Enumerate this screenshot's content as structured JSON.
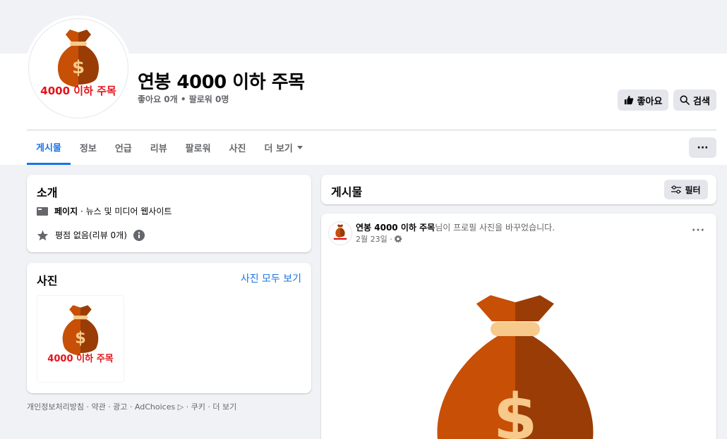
{
  "page": {
    "title": "연봉 4000 이하 주목",
    "stats": "좋아요 0개 • 팔로워 0명",
    "logo_text": "4000 이하 주목",
    "logo_symbol": "$"
  },
  "actions": {
    "like_label": "좋아요",
    "search_label": "검색",
    "more_label": "···"
  },
  "tabs": [
    {
      "label": "게시물"
    },
    {
      "label": "정보"
    },
    {
      "label": "언급"
    },
    {
      "label": "리뷰"
    },
    {
      "label": "팔로워"
    },
    {
      "label": "사진"
    },
    {
      "label": "더 보기"
    }
  ],
  "intro": {
    "title": "소개",
    "category_bold": "페이지",
    "category_rest": " · 뉴스 및 미디어 웹사이트",
    "rating": "평점 없음(리뷰 0개)"
  },
  "photos": {
    "title": "사진",
    "see_all": "사진 모두 보기"
  },
  "footer": {
    "text": "개인정보처리방침 · 약관 · 광고 · AdChoices ▷ · 쿠키 · 더 보기"
  },
  "posts": {
    "title": "게시물",
    "filter_label": "필터",
    "item": {
      "author": "연봉 4000 이하 주목",
      "action": "님이 프로필 사진을 바꾸었습니다.",
      "date": "2월 23일 ·",
      "more": "···"
    }
  },
  "colors": {
    "accent": "#1b74e4",
    "bag_left": "#c84f06",
    "bag_right": "#9a3c06",
    "bag_band": "#f7c98a",
    "logo_red": "#e3131a"
  }
}
